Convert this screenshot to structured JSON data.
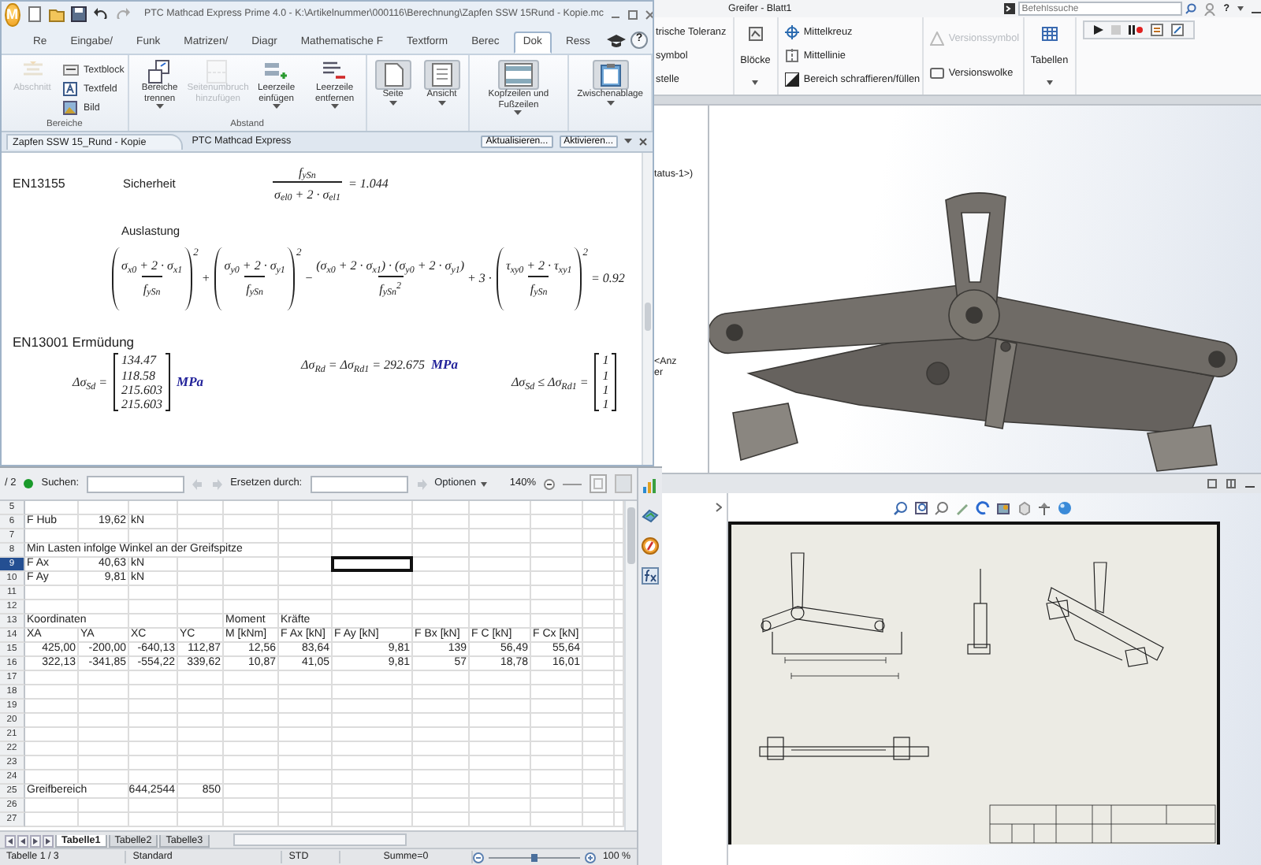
{
  "mathcad": {
    "logo": "M",
    "title": "PTC Mathcad Express Prime 4.0 - K:\\Artikelnummer\\000116\\Berechnung\\Zapfen SSW 15Rund - Kopie.mc",
    "tabs": [
      {
        "label": "Re",
        "selected": false
      },
      {
        "label": "Eingabe/",
        "selected": false
      },
      {
        "label": "Funk",
        "selected": false
      },
      {
        "label": "Matrizen/",
        "selected": false
      },
      {
        "label": "Diagr",
        "selected": false
      },
      {
        "label": "Mathematische F",
        "selected": false
      },
      {
        "label": "Textform",
        "selected": false
      },
      {
        "label": "Berec",
        "selected": false
      },
      {
        "label": "Dok",
        "selected": true
      },
      {
        "label": "Ress",
        "selected": false
      }
    ],
    "help": "?",
    "ribbon": [
      {
        "label": "Bereiche",
        "items": [
          {
            "kind": "large",
            "label": "Abschnitt",
            "disabled": true,
            "dropdown": false
          },
          {
            "kind": "small",
            "label": "Textblock",
            "disabled": false,
            "dropdown": false
          },
          {
            "kind": "small",
            "label": "Textfeld",
            "disabled": false,
            "dropdown": false
          },
          {
            "kind": "small",
            "label": "Bild",
            "disabled": false,
            "dropdown": false
          }
        ]
      },
      {
        "label": "Abstand",
        "items": [
          {
            "kind": "large",
            "label": "Bereiche trennen",
            "disabled": false,
            "dropdown": true
          },
          {
            "kind": "large",
            "label": "Seitenumbruch hinzufügen",
            "disabled": true,
            "dropdown": false
          },
          {
            "kind": "large",
            "label": "Leerzeile einfügen",
            "disabled": false,
            "dropdown": true
          },
          {
            "kind": "large",
            "label": "Leerzeile entfernen",
            "disabled": false,
            "dropdown": true
          }
        ]
      },
      {
        "items": [
          {
            "kind": "boxed",
            "label": "Seite",
            "disabled": false,
            "dropdown": true
          },
          {
            "kind": "boxed",
            "label": "Ansicht",
            "disabled": false,
            "dropdown": true
          }
        ]
      },
      {
        "items": [
          {
            "kind": "boxed",
            "label": "Kopfzeilen und Fußzeilen",
            "disabled": false,
            "dropdown": true
          }
        ]
      },
      {
        "items": [
          {
            "kind": "boxed",
            "label": "Zwischenablage",
            "disabled": false,
            "dropdown": true
          }
        ]
      }
    ],
    "doc_bar": {
      "tab": "Zapfen SSW 15_Rund - Kopie",
      "app": "PTC Mathcad Express",
      "buttons": [
        "Aktualisieren...",
        "Aktivieren..."
      ]
    },
    "worksheet": {
      "safety": {
        "standard": "EN13155",
        "label": "Sicherheit",
        "numerator": "f$_{ySn}$",
        "denominator": "σ$_{el0}$ + 2 · σ$_{el1}$",
        "result": "= 1.044"
      },
      "utilization": {
        "label": "Auslastung",
        "terms": [
          {
            "kind": "squared",
            "numerator": "σ$_{x0}$ + 2 · σ$_{x1}$",
            "denominator": "f$_{ySn}$",
            "exponent": "2"
          },
          {
            "kind": "squared",
            "sign": "+",
            "numerator": "σ$_{y0}$ + 2 · σ$_{y1}$",
            "denominator": "f$_{ySn}$",
            "exponent": "2"
          },
          {
            "kind": "fraction",
            "sign": "−",
            "numerator": "(σ$_{x0}$ + 2 · σ$_{x1}$) · (σ$_{y0}$ + 2 · σ$_{y1}$)",
            "denominator": "f$_{ySn}$$^{2}$"
          },
          {
            "kind": "squared",
            "sign": "+ 3 ·",
            "numerator": "τ$_{xy0}$ + 2 · τ$_{xy1}$",
            "denominator": "f$_{ySn}$",
            "exponent": "2"
          }
        ],
        "result": "= 0.92"
      },
      "fatigue": {
        "heading": "EN13001 Ermüdung",
        "stress": {
          "lhs": "Δσ$_{Sd}$ =",
          "values": [
            "134.47",
            "118.58",
            "215.603",
            "215.603"
          ],
          "unit": "MPa"
        },
        "resistance": {
          "text": "Δσ$_{Rd}$ = Δσ$_{Rd1}$ = 292.675",
          "unit": "MPa"
        },
        "check": {
          "lhs": "Δσ$_{Sd}$ ≤ Δσ$_{Rd1}$ =",
          "values": [
            "1",
            "1",
            "1",
            "1"
          ]
        }
      }
    }
  },
  "calc": {
    "find_bar": {
      "page": "/ 2",
      "search_label": "Suchen:",
      "replace_label": "Ersetzen durch:",
      "options": "Optionen",
      "zoom": "140%"
    },
    "rows": [
      {
        "number": "5",
        "selected": false,
        "cells": []
      },
      {
        "number": "6",
        "selected": false,
        "cells": [
          {
            "kind": "text",
            "text": "F Hub"
          },
          {
            "kind": "number",
            "text": "19,62"
          },
          {
            "kind": "text",
            "text": "kN"
          }
        ]
      },
      {
        "number": "7",
        "selected": false,
        "cells": []
      },
      {
        "number": "8",
        "selected": false,
        "cells": [
          {
            "kind": "text",
            "text": "Min Lasten infolge Winkel an der Greifspitze"
          }
        ]
      },
      {
        "number": "9",
        "selected": true,
        "cells": [
          {
            "kind": "text",
            "text": "F Ax"
          },
          {
            "kind": "number",
            "text": "40,63"
          },
          {
            "kind": "text",
            "text": "kN"
          },
          null,
          null,
          null,
          {
            "kind": "cursor"
          }
        ]
      },
      {
        "number": "10",
        "selected": false,
        "cells": [
          {
            "kind": "text",
            "text": "F Ay"
          },
          {
            "kind": "number",
            "text": "9,81"
          },
          {
            "kind": "text",
            "text": "kN"
          }
        ]
      },
      {
        "number": "11",
        "selected": false,
        "cells": []
      },
      {
        "number": "12",
        "selected": false,
        "cells": []
      },
      {
        "number": "13",
        "selected": false,
        "cells": [
          {
            "kind": "text",
            "text": "Koordinaten"
          },
          null,
          null,
          null,
          {
            "kind": "text",
            "text": "Moment"
          },
          {
            "kind": "text",
            "text": "Kräfte"
          }
        ]
      },
      {
        "number": "14",
        "selected": false,
        "cells": [
          {
            "kind": "text",
            "text": "XA"
          },
          {
            "kind": "text",
            "text": "YA"
          },
          {
            "kind": "text",
            "text": "XC"
          },
          {
            "kind": "text",
            "text": "YC"
          },
          {
            "kind": "text",
            "text": "M [kNm]"
          },
          {
            "kind": "text",
            "text": "F Ax [kN]"
          },
          {
            "kind": "text",
            "text": "F Ay [kN]"
          },
          {
            "kind": "text",
            "text": "F Bx [kN]"
          },
          {
            "kind": "text",
            "text": "F C [kN]"
          },
          {
            "kind": "text",
            "text": "F Cx [kN]"
          }
        ]
      },
      {
        "number": "15",
        "selected": false,
        "cells": [
          {
            "kind": "number",
            "text": "425,00"
          },
          {
            "kind": "number",
            "text": "-200,00"
          },
          {
            "kind": "number",
            "text": "-640,13"
          },
          {
            "kind": "number",
            "text": "112,87"
          },
          {
            "kind": "number",
            "text": "12,56"
          },
          {
            "kind": "number",
            "text": "83,64"
          },
          {
            "kind": "number",
            "text": "9,81"
          },
          {
            "kind": "number",
            "text": "139"
          },
          {
            "kind": "number",
            "text": "56,49"
          },
          {
            "kind": "number",
            "text": "55,64"
          }
        ]
      },
      {
        "number": "16",
        "selected": false,
        "cells": [
          {
            "kind": "number",
            "text": "322,13"
          },
          {
            "kind": "number",
            "text": "-341,85"
          },
          {
            "kind": "number",
            "text": "-554,22"
          },
          {
            "kind": "number",
            "text": "339,62"
          },
          {
            "kind": "number",
            "text": "10,87"
          },
          {
            "kind": "number",
            "text": "41,05"
          },
          {
            "kind": "number",
            "text": "9,81"
          },
          {
            "kind": "number",
            "text": "57"
          },
          {
            "kind": "number",
            "text": "18,78"
          },
          {
            "kind": "number",
            "text": "16,01"
          }
        ]
      },
      {
        "number": "17",
        "selected": false,
        "cells": []
      },
      {
        "number": "18",
        "selected": false,
        "cells": []
      },
      {
        "number": "19",
        "selected": false,
        "cells": []
      },
      {
        "number": "20",
        "selected": false,
        "cells": []
      },
      {
        "number": "21",
        "selected": false,
        "cells": []
      },
      {
        "number": "22",
        "selected": false,
        "cells": []
      },
      {
        "number": "23",
        "selected": false,
        "cells": []
      },
      {
        "number": "24",
        "selected": false,
        "cells": []
      },
      {
        "number": "25",
        "selected": false,
        "cells": [
          {
            "kind": "text",
            "text": "Greifbereich"
          },
          null,
          {
            "kind": "number",
            "text": "644,2544"
          },
          {
            "kind": "number",
            "text": "850"
          }
        ]
      },
      {
        "number": "26",
        "selected": false,
        "cells": []
      },
      {
        "number": "27",
        "selected": false,
        "cells": []
      }
    ],
    "sheet_tabs": [
      {
        "label": "Tabelle1",
        "selected": true
      },
      {
        "label": "Tabelle2",
        "selected": false
      },
      {
        "label": "Tabelle3",
        "selected": false
      }
    ],
    "status_bar": {
      "sheet": "Tabelle 1 / 3",
      "style": "Standard",
      "mode": "STD",
      "sum": "Summe=0",
      "zoom": "100 %",
      "zoom_slider": {
        "level": 0.5
      }
    }
  },
  "cad": {
    "title": "Greifer - Blatt1",
    "search": {
      "placeholder": "Befehlssuche"
    },
    "help": "?",
    "ribbon_cut": [
      "trische Toleranz",
      "symbol",
      "stelle"
    ],
    "blocks": "Blöcke",
    "annotations": [
      {
        "label": "Mittelkreuz",
        "disabled": false
      },
      {
        "label": "Mittellinie",
        "disabled": false
      },
      {
        "label": "Bereich schraffieren/füllen",
        "disabled": false
      },
      {
        "label": "Versionssymbol",
        "disabled": true
      },
      {
        "label": "Versionswolke",
        "disabled": false
      }
    ],
    "tables": "Tabellen",
    "tree_fragments": [
      "tatus-1>)",
      "<Anz",
      "er"
    ]
  }
}
